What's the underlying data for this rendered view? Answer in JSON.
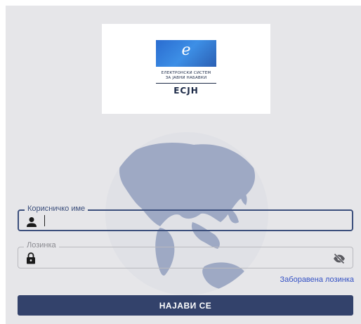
{
  "logo": {
    "mark": "e",
    "line1": "ЕЛЕКТРОНСКИ СИСТЕМ",
    "line2": "ЗА ЈАВНИ НАБАВКИ",
    "abbr": "ЕСЈН"
  },
  "form": {
    "username": {
      "label": "Корисничко име",
      "value": "",
      "icon": "person-icon"
    },
    "password": {
      "label": "Лозинка",
      "value": "",
      "icon": "lock-icon",
      "toggle_icon": "eye-off-icon"
    },
    "forgot_password": "Заборавена лозинка",
    "submit": "НАЈАВИ СЕ"
  },
  "colors": {
    "background": "#e6e6e9",
    "primary": "#33426b",
    "focus_border": "#3c4f7c",
    "link": "#3451c4"
  }
}
